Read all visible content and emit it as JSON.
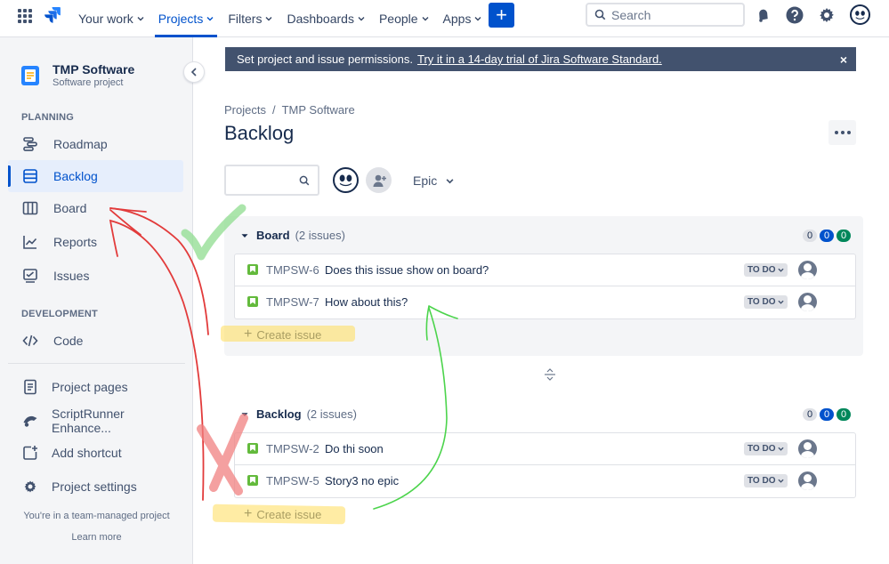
{
  "topnav": {
    "items": [
      {
        "label": "Your work",
        "active": false
      },
      {
        "label": "Projects",
        "active": true
      },
      {
        "label": "Filters",
        "active": false
      },
      {
        "label": "Dashboards",
        "active": false
      },
      {
        "label": "People",
        "active": false
      },
      {
        "label": "Apps",
        "active": false
      }
    ],
    "create_label": "+",
    "search_placeholder": "Search"
  },
  "sidebar": {
    "project_name": "TMP Software",
    "project_type": "Software project",
    "planning_heading": "PLANNING",
    "planning_items": [
      {
        "label": "Roadmap",
        "icon": "roadmap-icon",
        "active": false
      },
      {
        "label": "Backlog",
        "icon": "backlog-icon",
        "active": true
      },
      {
        "label": "Board",
        "icon": "board-icon",
        "active": false
      },
      {
        "label": "Reports",
        "icon": "reports-icon",
        "active": false
      },
      {
        "label": "Issues",
        "icon": "issues-icon",
        "active": false
      }
    ],
    "development_heading": "DEVELOPMENT",
    "development_items": [
      {
        "label": "Code",
        "icon": "code-icon"
      }
    ],
    "other_items": [
      {
        "label": "Project pages",
        "icon": "page-icon"
      },
      {
        "label": "ScriptRunner Enhance...",
        "icon": "scriptrunner-icon"
      },
      {
        "label": "Add shortcut",
        "icon": "add-shortcut-icon"
      },
      {
        "label": "Project settings",
        "icon": "gear-icon"
      }
    ],
    "team_note": "You're in a team-managed project",
    "learn_more": "Learn more"
  },
  "banner": {
    "text": "Set project and issue permissions.",
    "link": "Try it in a 14-day trial of Jira Software Standard.",
    "close": "×"
  },
  "breadcrumb": {
    "items": [
      "Projects",
      "TMP Software"
    ],
    "separator": "/"
  },
  "page_title": "Backlog",
  "filters": {
    "epic_label": "Epic"
  },
  "sections": [
    {
      "title": "Board",
      "count_text": "(2 issues)",
      "counts": [
        "0",
        "0",
        "0"
      ],
      "issues": [
        {
          "key": "TMPSW-6",
          "summary": "Does this issue show on board?",
          "status": "TO DO"
        },
        {
          "key": "TMPSW-7",
          "summary": "How about this?",
          "status": "TO DO"
        }
      ],
      "create_label": "Create issue"
    },
    {
      "title": "Backlog",
      "count_text": "(2 issues)",
      "counts": [
        "0",
        "0",
        "0"
      ],
      "issues": [
        {
          "key": "TMPSW-2",
          "summary": "Do thi soon",
          "status": "TO DO"
        },
        {
          "key": "TMPSW-5",
          "summary": "Story3 no epic",
          "status": "TO DO"
        }
      ],
      "create_label": "Create issue"
    }
  ],
  "colors": {
    "brand": "#0052cc",
    "banner": "#42526e",
    "story": "#63ba3c",
    "count_blue": "#0052cc",
    "count_green": "#00875a",
    "annotation_red": "#e23b3b",
    "annotation_green": "#4cd44c",
    "annotation_yellow": "#ffdc5a"
  }
}
